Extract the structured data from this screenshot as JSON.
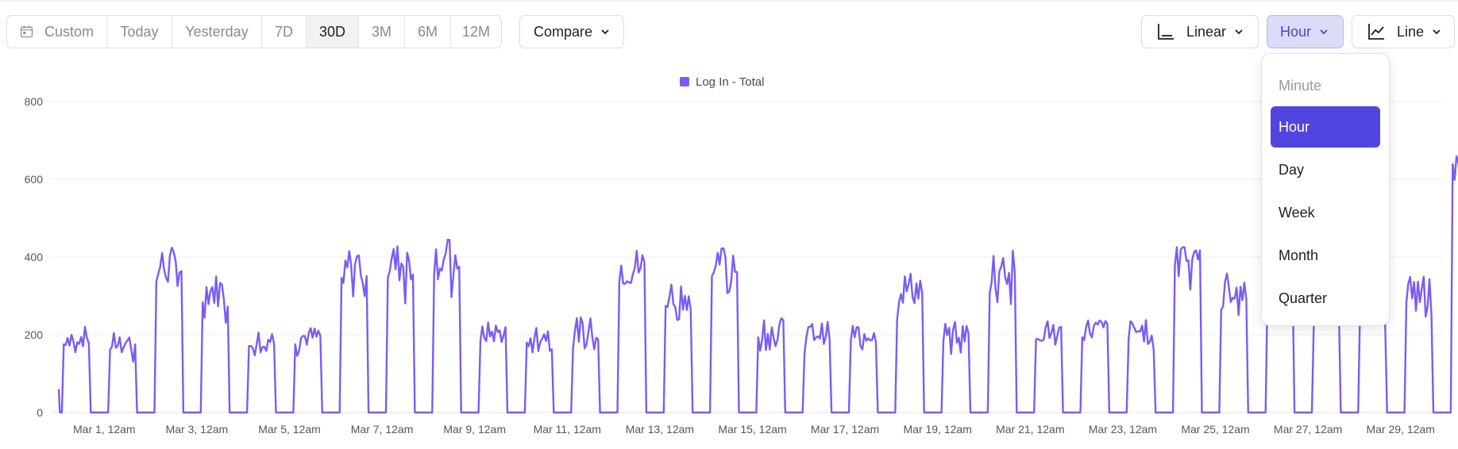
{
  "toolbar": {
    "date_range": {
      "custom_label": "Custom",
      "options": [
        "Today",
        "Yesterday",
        "7D",
        "30D",
        "3M",
        "6M",
        "12M"
      ],
      "selected": "30D"
    },
    "compare_label": "Compare",
    "scale_label": "Linear",
    "interval_label": "Hour",
    "chart_type_label": "Line"
  },
  "interval_menu": {
    "items": [
      {
        "label": "Minute",
        "state": "disabled"
      },
      {
        "label": "Hour",
        "state": "selected"
      },
      {
        "label": "Day",
        "state": "normal"
      },
      {
        "label": "Week",
        "state": "normal"
      },
      {
        "label": "Month",
        "state": "normal"
      },
      {
        "label": "Quarter",
        "state": "normal"
      }
    ]
  },
  "colors": {
    "series": "#7b5cf5",
    "accent": "#5145e0",
    "active_pill_bg": "#dddcf7"
  },
  "chart_data": {
    "type": "line",
    "legend": [
      "Log In - Total"
    ],
    "legend_position": "top-center",
    "grid": true,
    "ylim": [
      0,
      800
    ],
    "yticks": [
      0,
      200,
      400,
      600,
      800
    ],
    "xticks": [
      "Mar 1, 12am",
      "Mar 3, 12am",
      "Mar 5, 12am",
      "Mar 7, 12am",
      "Mar 9, 12am",
      "Mar 11, 12am",
      "Mar 13, 12am",
      "Mar 15, 12am",
      "Mar 17, 12am",
      "Mar 19, 12am",
      "Mar 21, 12am",
      "Mar 23, 12am",
      "Mar 25, 12am",
      "Mar 27, 12am",
      "Mar 29, 12am"
    ],
    "x_start": "Feb 28, 12am",
    "x_interval": "hour",
    "series": [
      {
        "name": "Log In - Total",
        "daily_approx_peak_levels": [
          195,
          180,
          375,
          315,
          190,
          195,
          385,
          385,
          395,
          205,
          200,
          215,
          375,
          305,
          390,
          215,
          205,
          205,
          320,
          205,
          370,
          210,
          215,
          210,
          420,
          320,
          380,
          300,
          300,
          315,
          710
        ],
        "note_values": "hourly values: 0 overnight, day-level above during working hours"
      }
    ]
  }
}
